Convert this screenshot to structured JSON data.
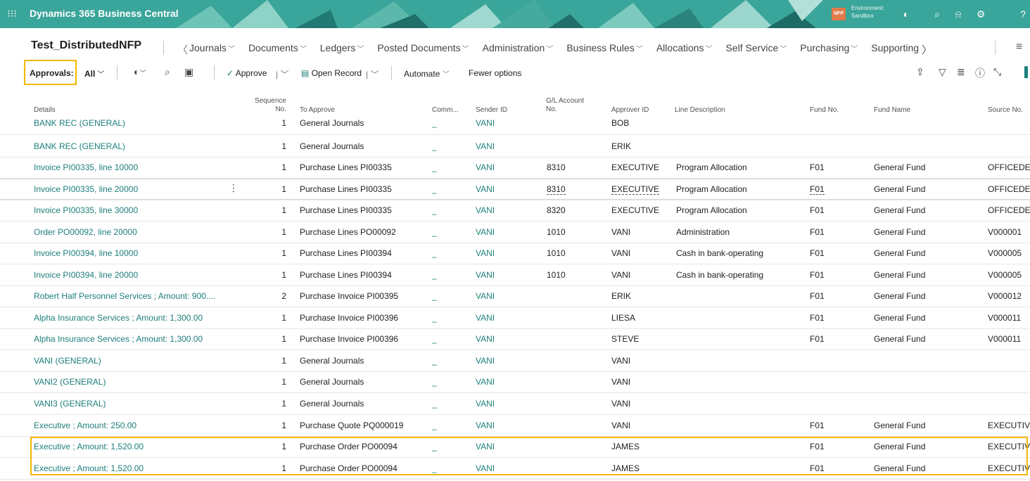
{
  "header": {
    "app_title": "Dynamics 365 Business Central",
    "env_badge": "NFP",
    "env_label": "Environment:",
    "env_name": "Sandbox"
  },
  "page": {
    "title": "Test_DistributedNFP"
  },
  "nav": {
    "items": [
      "Journals",
      "Documents",
      "Ledgers",
      "Posted Documents",
      "Administration",
      "Business Rules",
      "Allocations",
      "Self Service",
      "Purchasing",
      "Supporting"
    ]
  },
  "actions": {
    "approvals_label": "Approvals:",
    "filter_value": "All",
    "approve_label": "Approve",
    "open_record_label": "Open Record",
    "automate_label": "Automate",
    "fewer_options_label": "Fewer options"
  },
  "table": {
    "headers": {
      "details": "Details",
      "sequence_1": "Sequence",
      "sequence_2": "No.",
      "to_approve": "To Approve",
      "comments": "Comm...",
      "sender_id": "Sender ID",
      "gl_1": "G/L Account",
      "gl_2": "No.",
      "approver_id": "Approver ID",
      "line_description": "Line Description",
      "fund_no": "Fund No.",
      "fund_name": "Fund Name",
      "source_no": "Source No."
    },
    "rows": [
      {
        "details": "BANK REC (GENERAL)",
        "seq": "1",
        "to_approve": "General Journals",
        "comm": "_",
        "sender": "VANI",
        "gl": "",
        "approver": "BOB",
        "desc": "",
        "fund_no": "",
        "fund_name": "",
        "source": ""
      },
      {
        "details": "BANK REC (GENERAL)",
        "seq": "1",
        "to_approve": "General Journals",
        "comm": "_",
        "sender": "VANI",
        "gl": "",
        "approver": "ERIK",
        "desc": "",
        "fund_no": "",
        "fund_name": "",
        "source": ""
      },
      {
        "details": "Invoice PI00335, line 10000",
        "seq": "1",
        "to_approve": "Purchase Lines PI00335",
        "comm": "_",
        "sender": "VANI",
        "gl": "8310",
        "approver": "EXECUTIVE",
        "desc": "Program Allocation",
        "fund_no": "F01",
        "fund_name": "General Fund",
        "source": "OFFICEDEI"
      },
      {
        "details": "Invoice PI00335, line 20000",
        "seq": "1",
        "to_approve": "Purchase Lines PI00335",
        "comm": "_",
        "sender": "VANI",
        "gl": "8310",
        "approver": "EXECUTIVE",
        "desc": "Program Allocation",
        "fund_no": "F01",
        "fund_name": "General Fund",
        "source": "OFFICEDEI"
      },
      {
        "details": "Invoice PI00335, line 30000",
        "seq": "1",
        "to_approve": "Purchase Lines PI00335",
        "comm": "_",
        "sender": "VANI",
        "gl": "8320",
        "approver": "EXECUTIVE",
        "desc": "Program Allocation",
        "fund_no": "F01",
        "fund_name": "General Fund",
        "source": "OFFICEDEI"
      },
      {
        "details": "Order PO00092, line 20000",
        "seq": "1",
        "to_approve": "Purchase Lines PO00092",
        "comm": "_",
        "sender": "VANI",
        "gl": "1010",
        "approver": "VANI",
        "desc": "Administration",
        "fund_no": "F01",
        "fund_name": "General Fund",
        "source": "V000001"
      },
      {
        "details": "Invoice PI00394, line 10000",
        "seq": "1",
        "to_approve": "Purchase Lines PI00394",
        "comm": "_",
        "sender": "VANI",
        "gl": "1010",
        "approver": "VANI",
        "desc": "Cash in bank-operating",
        "fund_no": "F01",
        "fund_name": "General Fund",
        "source": "V000005"
      },
      {
        "details": "Invoice PI00394, line 20000",
        "seq": "1",
        "to_approve": "Purchase Lines PI00394",
        "comm": "_",
        "sender": "VANI",
        "gl": "1010",
        "approver": "VANI",
        "desc": "Cash in bank-operating",
        "fund_no": "F01",
        "fund_name": "General Fund",
        "source": "V000005"
      },
      {
        "details": "Robert Half Personnel Services ; Amount: 900....",
        "seq": "2",
        "to_approve": "Purchase Invoice PI00395",
        "comm": "_",
        "sender": "VANI",
        "gl": "",
        "approver": "ERIK",
        "desc": "",
        "fund_no": "F01",
        "fund_name": "General Fund",
        "source": "V000012"
      },
      {
        "details": "Alpha Insurance Services ; Amount: 1,300.00",
        "seq": "1",
        "to_approve": "Purchase Invoice PI00396",
        "comm": "_",
        "sender": "VANI",
        "gl": "",
        "approver": "LIESA",
        "desc": "",
        "fund_no": "F01",
        "fund_name": "General Fund",
        "source": "V000011"
      },
      {
        "details": "Alpha Insurance Services ; Amount: 1,300.00",
        "seq": "1",
        "to_approve": "Purchase Invoice PI00396",
        "comm": "_",
        "sender": "VANI",
        "gl": "",
        "approver": "STEVE",
        "desc": "",
        "fund_no": "F01",
        "fund_name": "General Fund",
        "source": "V000011"
      },
      {
        "details": "VANI (GENERAL)",
        "seq": "1",
        "to_approve": "General Journals",
        "comm": "_",
        "sender": "VANI",
        "gl": "",
        "approver": "VANI",
        "desc": "",
        "fund_no": "",
        "fund_name": "",
        "source": ""
      },
      {
        "details": "VANI2 (GENERAL)",
        "seq": "1",
        "to_approve": "General Journals",
        "comm": "_",
        "sender": "VANI",
        "gl": "",
        "approver": "VANI",
        "desc": "",
        "fund_no": "",
        "fund_name": "",
        "source": ""
      },
      {
        "details": "VANI3 (GENERAL)",
        "seq": "1",
        "to_approve": "General Journals",
        "comm": "_",
        "sender": "VANI",
        "gl": "",
        "approver": "VANI",
        "desc": "",
        "fund_no": "",
        "fund_name": "",
        "source": ""
      },
      {
        "details": "Executive ; Amount: 250.00",
        "seq": "1",
        "to_approve": "Purchase Quote PQ000019",
        "comm": "_",
        "sender": "VANI",
        "gl": "",
        "approver": "VANI",
        "desc": "",
        "fund_no": "F01",
        "fund_name": "General Fund",
        "source": "EXECUTIVI"
      },
      {
        "details": "Executive ; Amount: 1,520.00",
        "seq": "1",
        "to_approve": "Purchase Order PO00094",
        "comm": "_",
        "sender": "VANI",
        "gl": "",
        "approver": "JAMES",
        "desc": "",
        "fund_no": "F01",
        "fund_name": "General Fund",
        "source": "EXECUTIV"
      },
      {
        "details": "Executive ; Amount: 1,520.00",
        "seq": "1",
        "to_approve": "Purchase Order PO00094",
        "comm": "_",
        "sender": "VANI",
        "gl": "",
        "approver": "JAMES",
        "desc": "",
        "fund_no": "F01",
        "fund_name": "General Fund",
        "source": "EXECUTIV"
      }
    ]
  },
  "colors": {
    "banner": "#3aa59a",
    "link": "#1c7f7a",
    "highlight": "#f5b800"
  }
}
